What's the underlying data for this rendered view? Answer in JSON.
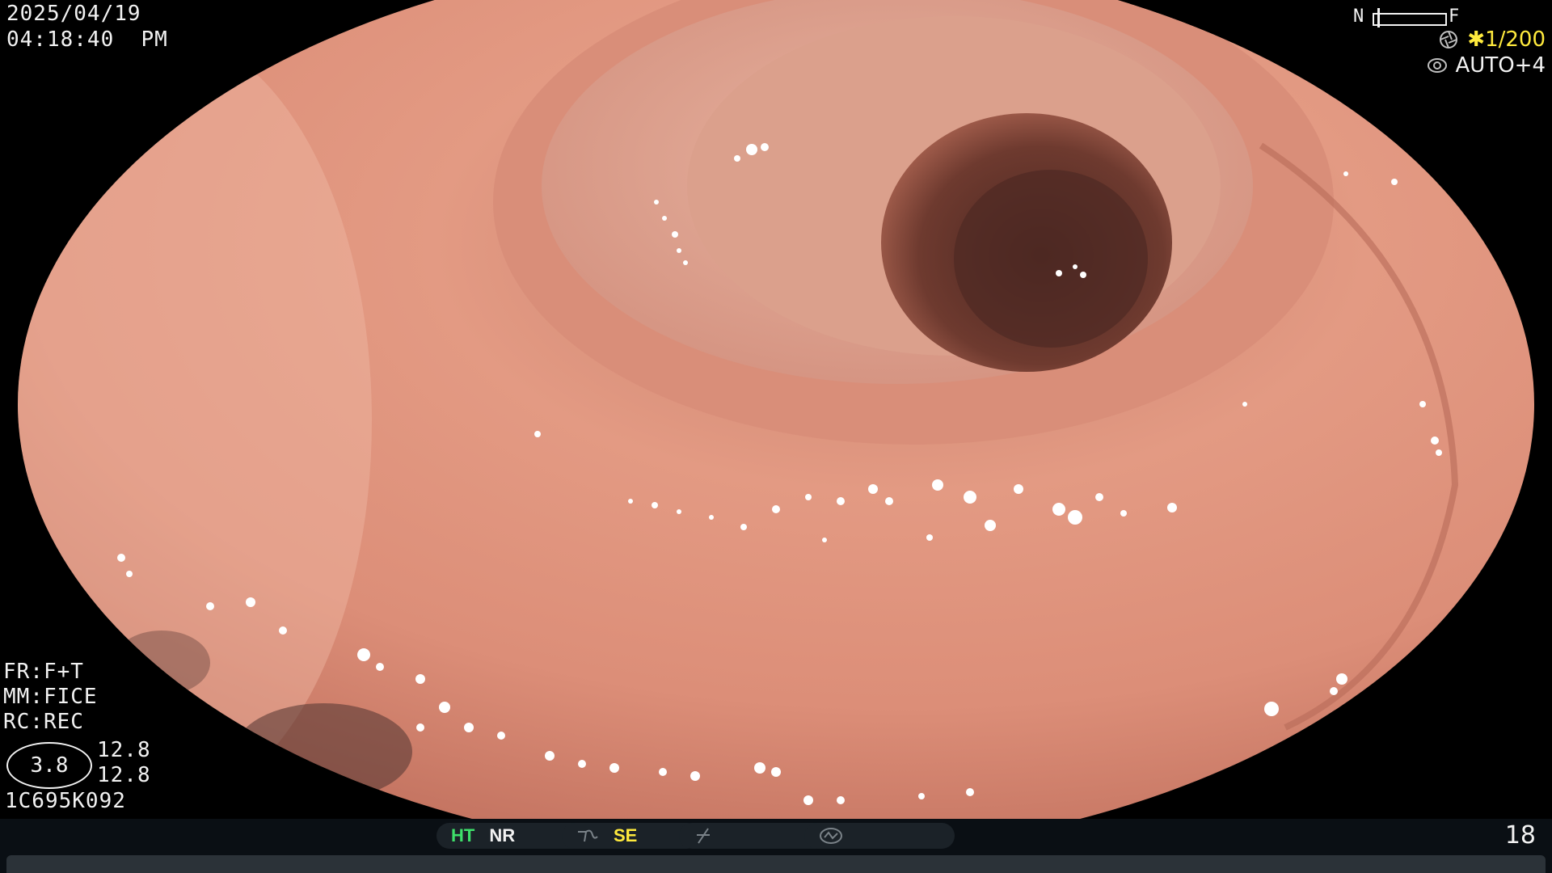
{
  "overlay": {
    "date": "2025/04/19",
    "time": "04:18:40  PM",
    "focus": {
      "near_label": "N",
      "far_label": "F"
    },
    "shutter": "✱1/200",
    "exposure": "AUTO+4",
    "fr": "FR:F+T",
    "mm": "MM:FICE",
    "rc": "RC:REC",
    "zoom": "3.8",
    "value_a": "12.8",
    "value_b": "12.8",
    "scope_id": "1C695K092"
  },
  "status_bar": {
    "ht": "HT",
    "nr": "NR",
    "se": "SE",
    "page_number": "18"
  },
  "colors": {
    "background": "#000000",
    "mucosa": "#d88a72",
    "lumen": "#5a3027",
    "ht_green": "#3ee06a",
    "se_yellow": "#ffea3d"
  },
  "icons": [
    "aperture-icon",
    "iris-icon",
    "wave-icon",
    "slash-icon",
    "gauge-icon"
  ]
}
